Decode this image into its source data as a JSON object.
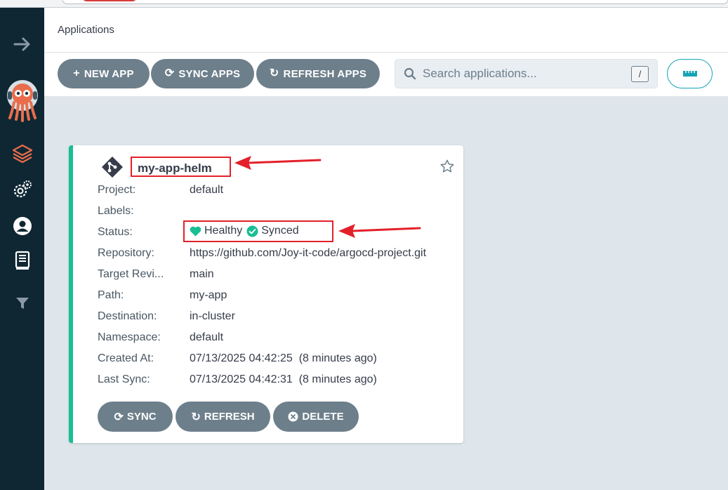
{
  "header": {
    "title": "Applications"
  },
  "toolbar": {
    "new_app": "NEW APP",
    "sync_apps": "SYNC APPS",
    "refresh_apps": "REFRESH APPS",
    "search_placeholder": "Search applications...",
    "search_shortcut": "/"
  },
  "sidebar": {
    "items": [
      {
        "icon": "arrow-right-icon"
      },
      {
        "icon": "argo-octopus-logo"
      },
      {
        "icon": "layers-icon",
        "active": true
      },
      {
        "icon": "gear-icon"
      },
      {
        "icon": "user-icon"
      },
      {
        "icon": "book-icon"
      },
      {
        "icon": "filter-icon"
      }
    ]
  },
  "app": {
    "name": "my-app-helm",
    "fields": [
      {
        "label": "Project:",
        "value": "default"
      },
      {
        "label": "Labels:",
        "value": ""
      },
      {
        "label": "Status:",
        "value": ""
      },
      {
        "label": "Repository:",
        "value": "https://github.com/Joy-it-code/argocd-project.git"
      },
      {
        "label": "Target Revi...",
        "value": "main"
      },
      {
        "label": "Path:",
        "value": "my-app"
      },
      {
        "label": "Destination:",
        "value": "in-cluster"
      },
      {
        "label": "Namespace:",
        "value": "default"
      },
      {
        "label": "Created At:",
        "value": "07/13/2025 04:42:25  (8 minutes ago)"
      },
      {
        "label": "Last Sync:",
        "value": "07/13/2025 04:42:31  (8 minutes ago)"
      }
    ],
    "health": "Healthy",
    "sync": "Synced",
    "actions": {
      "sync": "SYNC",
      "refresh": "REFRESH",
      "delete": "DELETE"
    }
  },
  "colors": {
    "sidebar_bg": "#0f2733",
    "accent_orange": "#e96d4c",
    "healthy_green": "#18be94",
    "button_gray": "#6d7f8b",
    "annotation_red": "#e3202a"
  }
}
